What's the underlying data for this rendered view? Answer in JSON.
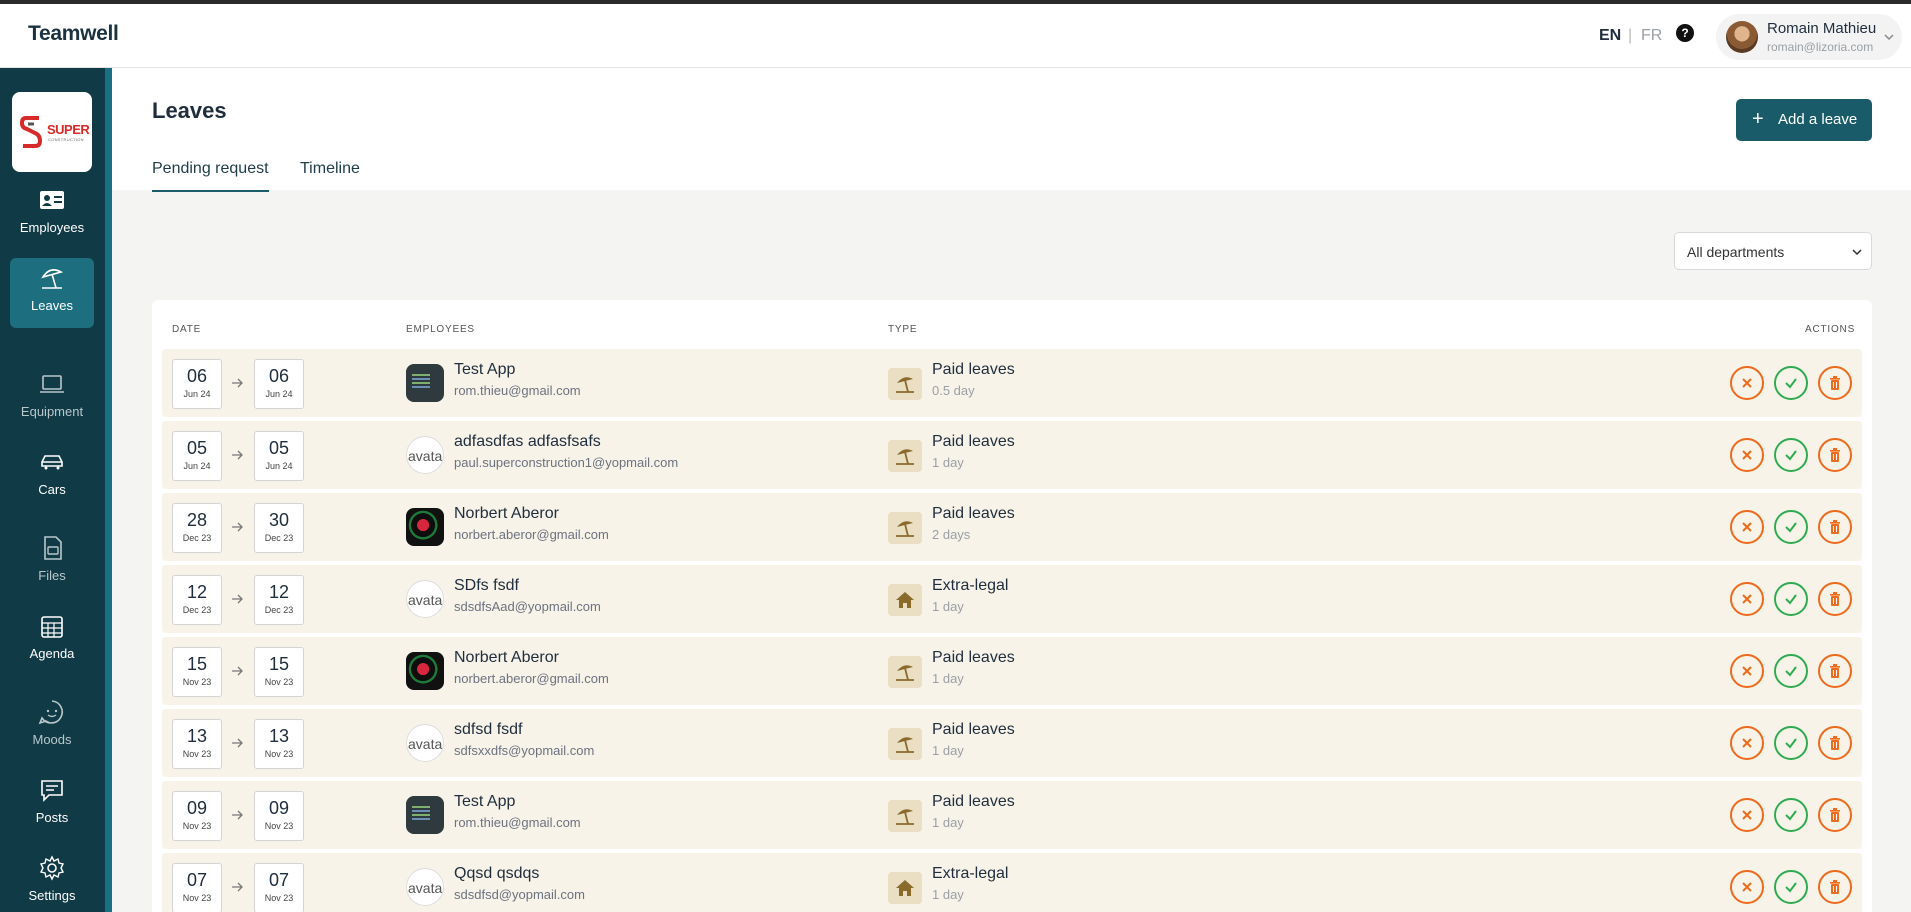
{
  "app": {
    "brand": "Teamwell"
  },
  "header": {
    "lang_en": "EN",
    "lang_sep": "|",
    "lang_fr": "FR",
    "help": "?",
    "user": {
      "name": "Romain Mathieu",
      "email": "romain@lizoria.com"
    }
  },
  "company": {
    "logo_text": "SUPER",
    "logo_sub": "CONSTRUCTION"
  },
  "sidebar": {
    "items": [
      {
        "label": "Employees",
        "icon": "id-card-icon"
      },
      {
        "label": "Leaves",
        "icon": "umbrella-beach-icon"
      },
      {
        "label": "Equipment",
        "icon": "laptop-icon"
      },
      {
        "label": "Cars",
        "icon": "car-icon"
      },
      {
        "label": "Files",
        "icon": "file-icon"
      },
      {
        "label": "Agenda",
        "icon": "calendar-icon"
      },
      {
        "label": "Moods",
        "icon": "smiley-icon"
      },
      {
        "label": "Posts",
        "icon": "message-icon"
      },
      {
        "label": "Settings",
        "icon": "gear-icon"
      }
    ]
  },
  "page": {
    "title": "Leaves",
    "add_button": "Add a leave",
    "tabs": [
      "Pending request",
      "Timeline"
    ],
    "department_filter": "All departments"
  },
  "table": {
    "headers": {
      "date": "DATE",
      "employees": "EMPLOYEES",
      "type": "TYPE",
      "actions": "ACTIONS"
    },
    "rows": [
      {
        "from_day": "06",
        "from_month": "Jun 24",
        "to_day": "06",
        "to_month": "Jun 24",
        "name": "Test App",
        "email": "rom.thieu@gmail.com",
        "avatar": "app",
        "type": "Paid leaves",
        "duration": "0.5 day",
        "type_icon": "umbrella-beach-icon"
      },
      {
        "from_day": "05",
        "from_month": "Jun 24",
        "to_day": "05",
        "to_month": "Jun 24",
        "name": "adfasdfas adfasfsafs",
        "email": "paul.superconstruction1@yopmail.com",
        "avatar": "broken",
        "avatar_alt": "avatar",
        "type": "Paid leaves",
        "duration": "1 day",
        "type_icon": "umbrella-beach-icon"
      },
      {
        "from_day": "28",
        "from_month": "Dec 23",
        "to_day": "30",
        "to_month": "Dec 23",
        "name": "Norbert Aberor",
        "email": "norbert.aberor@gmail.com",
        "avatar": "art",
        "type": "Paid leaves",
        "duration": "2 days",
        "type_icon": "umbrella-beach-icon"
      },
      {
        "from_day": "12",
        "from_month": "Dec 23",
        "to_day": "12",
        "to_month": "Dec 23",
        "name": "SDfs fsdf",
        "email": "sdsdfsAad@yopmail.com",
        "avatar": "broken",
        "avatar_alt": "avatar",
        "type": "Extra-legal",
        "duration": "1 day",
        "type_icon": "house-icon"
      },
      {
        "from_day": "15",
        "from_month": "Nov 23",
        "to_day": "15",
        "to_month": "Nov 23",
        "name": "Norbert Aberor",
        "email": "norbert.aberor@gmail.com",
        "avatar": "art",
        "type": "Paid leaves",
        "duration": "1 day",
        "type_icon": "umbrella-beach-icon"
      },
      {
        "from_day": "13",
        "from_month": "Nov 23",
        "to_day": "13",
        "to_month": "Nov 23",
        "name": "sdfsd fsdf",
        "email": "sdfsxxdfs@yopmail.com",
        "avatar": "broken",
        "avatar_alt": "avatar",
        "type": "Paid leaves",
        "duration": "1 day",
        "type_icon": "umbrella-beach-icon"
      },
      {
        "from_day": "09",
        "from_month": "Nov 23",
        "to_day": "09",
        "to_month": "Nov 23",
        "name": "Test App",
        "email": "rom.thieu@gmail.com",
        "avatar": "app",
        "type": "Paid leaves",
        "duration": "1 day",
        "type_icon": "umbrella-beach-icon"
      },
      {
        "from_day": "07",
        "from_month": "Nov 23",
        "to_day": "07",
        "to_month": "Nov 23",
        "name": "Qqsd qsdqs",
        "email": "sdsdfsd@yopmail.com",
        "avatar": "broken",
        "avatar_alt": "avatar",
        "type": "Extra-legal",
        "duration": "1 day",
        "type_icon": "house-icon"
      }
    ]
  },
  "colors": {
    "sidebar": "#103a45",
    "accent": "#1a5b6a",
    "row_bg": "#f7f3e8",
    "reject": "#ee6a1d",
    "approve": "#2eac52"
  }
}
